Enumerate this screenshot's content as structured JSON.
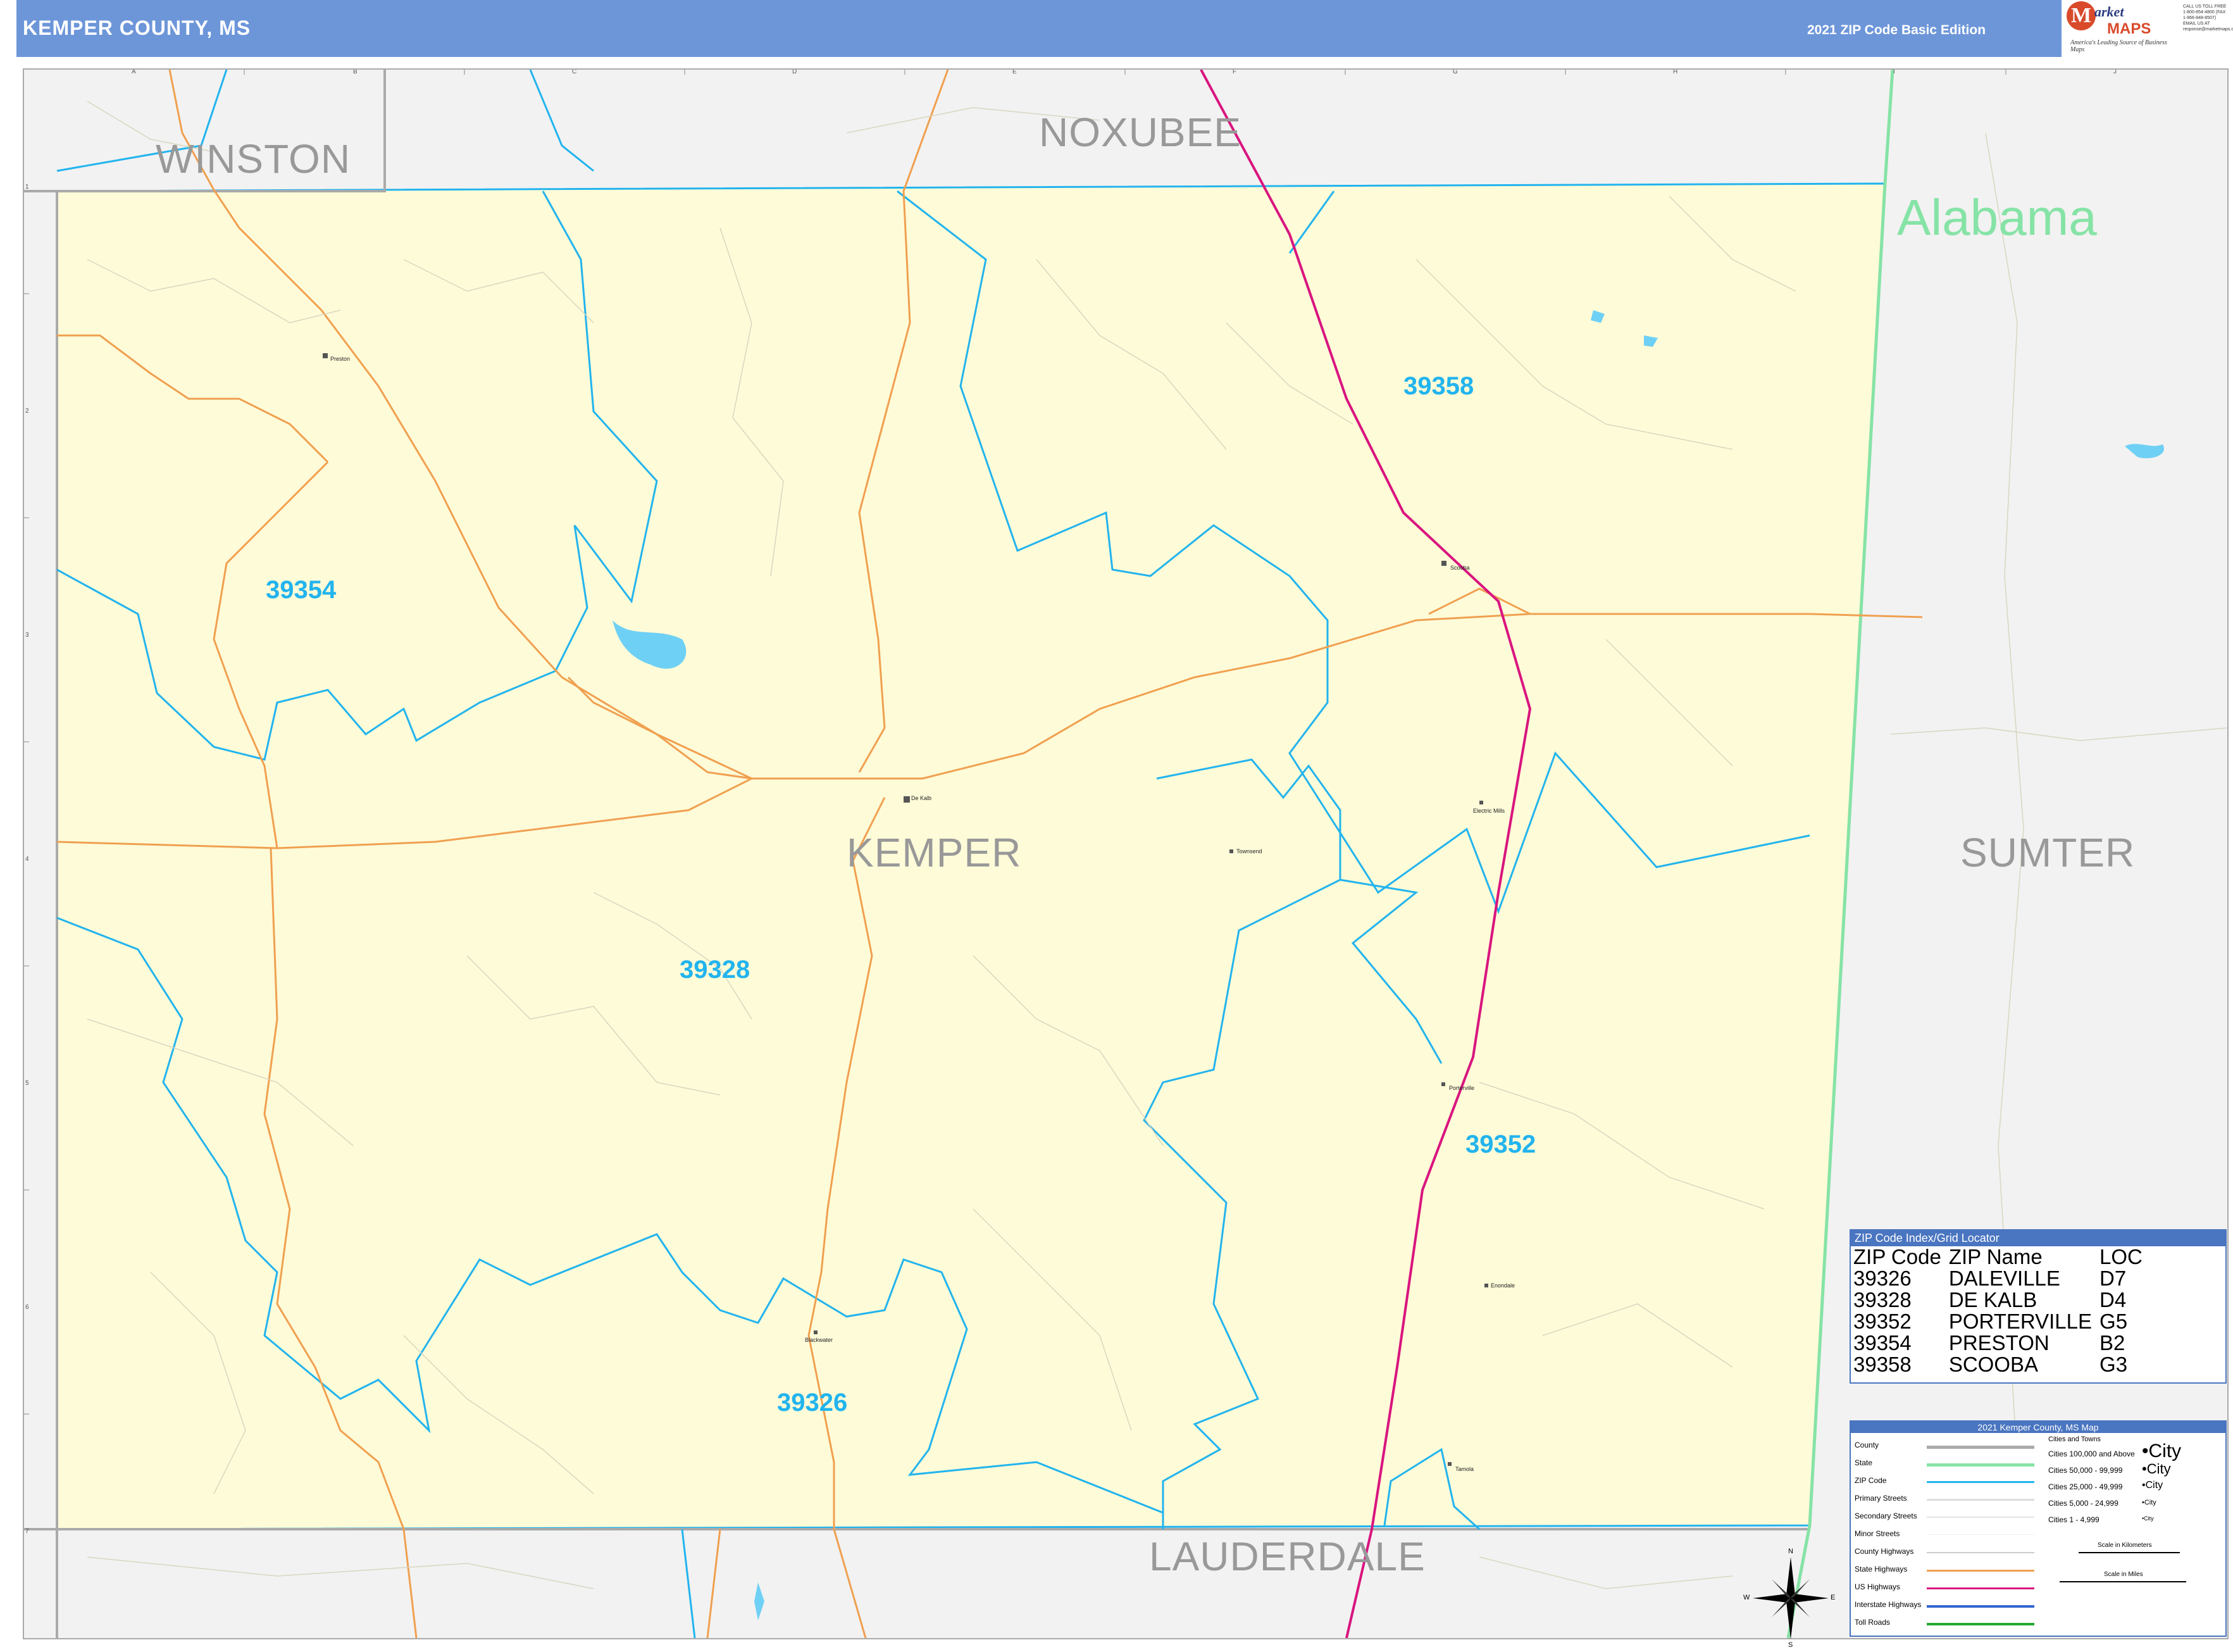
{
  "header": {
    "title": "KEMPER COUNTY, MS",
    "edition": "2021 ZIP Code Basic Edition"
  },
  "logo": {
    "m": "M",
    "arket": "arket",
    "maps": "MAPS",
    "tagline": "America's Leading Source of Business Maps",
    "info": "CALL US TOLL FREE 1-800-854-4800 (FAX 1-866-848-8507) EMAIL US AT response@marketmaps.com"
  },
  "grid": {
    "columns": [
      "A",
      "B",
      "C",
      "D",
      "E",
      "F",
      "G",
      "H",
      "I",
      "J"
    ],
    "rows": [
      "1",
      "2",
      "3",
      "4",
      "5",
      "6",
      "7"
    ]
  },
  "counties": {
    "main": "KEMPER",
    "north_west": "WINSTON",
    "north": "NOXUBEE",
    "east": "SUMTER",
    "south": "LAUDERDALE"
  },
  "state_label": "Alabama",
  "zip_labels": [
    "39358",
    "39354",
    "39328",
    "39352",
    "39326"
  ],
  "towns": [
    "Preston",
    "Scooba",
    "De Kalb",
    "Townsend",
    "Electric Mills",
    "Porterville",
    "Blackwater",
    "Enondale",
    "Tamola"
  ],
  "zip_index": {
    "title": "ZIP Code Index/Grid Locator",
    "columns": [
      "ZIP Code",
      "ZIP Name",
      "LOC"
    ],
    "rows": [
      [
        "39326",
        "DALEVILLE",
        "D7"
      ],
      [
        "39328",
        "DE KALB",
        "D4"
      ],
      [
        "39352",
        "PORTERVILLE",
        "G5"
      ],
      [
        "39354",
        "PRESTON",
        "B2"
      ],
      [
        "39358",
        "SCOOBA",
        "G3"
      ]
    ]
  },
  "legend": {
    "title": "2021 Kemper County, MS Map",
    "items": [
      "County",
      "State",
      "ZIP Code",
      "Primary Streets",
      "Secondary Streets",
      "Minor Streets",
      "County Highways",
      "State Highways",
      "US Highways",
      "Interstate Highways",
      "Toll Roads"
    ],
    "cities_heading": "Cities and Towns",
    "cities": [
      {
        "range": "Cities 100,000 and Above",
        "sample": "•City"
      },
      {
        "range": "Cities 50,000 - 99,999",
        "sample": "•City"
      },
      {
        "range": "Cities 25,000 - 49,999",
        "sample": "•City"
      },
      {
        "range": "Cities 5,000 - 24,999",
        "sample": "•City"
      },
      {
        "range": "Cities 1 - 4,999",
        "sample": "•City"
      }
    ],
    "scale_km": "Scale in Kilometers",
    "scale_mi": "Scale in Miles",
    "colors": {
      "county": "#aaaaaa",
      "state": "#86e3a6",
      "zip": "#22b4ee",
      "state_highway": "#f0a050",
      "us_highway": "#d9157f",
      "interstate": "#3366cc",
      "toll": "#22aa33"
    }
  },
  "compass": {
    "n": "N",
    "s": "S",
    "e": "E",
    "w": "W"
  },
  "colors": {
    "county_fill": "#fefbd8",
    "outside_fill": "#f2f2f2",
    "header": "#6d96d9",
    "zip_line": "#22b4ee",
    "us_highway": "#d9157f",
    "state_highway": "#f0a050",
    "water": "#6fd0f5"
  }
}
